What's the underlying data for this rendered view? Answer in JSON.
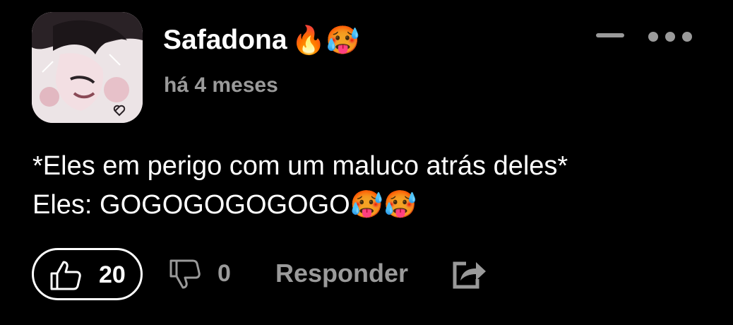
{
  "comment": {
    "author": "Safadona",
    "author_emojis": "🔥🥵",
    "time_ago": "há 4 meses",
    "text_lines": [
      "*Eles em perigo com um maluco atrás deles*",
      "Eles: GOGOGOGOGOGO🥵🥵"
    ]
  },
  "actions": {
    "like_count": "20",
    "dislike_count": "0",
    "reply_label": "Responder"
  },
  "icons": {
    "avatar": "anime-avatar",
    "collapse": "minus-icon",
    "more": "more-horizontal-icon",
    "like": "thumbs-up-icon",
    "dislike": "thumbs-down-icon",
    "share": "share-icon"
  },
  "colors": {
    "background": "#000000",
    "text_primary": "#ffffff",
    "text_secondary": "#9a9a9a"
  }
}
